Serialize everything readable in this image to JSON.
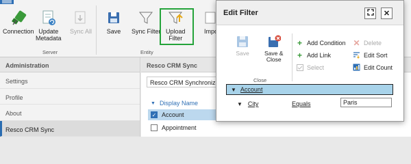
{
  "ribbon": {
    "buttons": [
      {
        "label": "Connection",
        "icon": "plug-icon"
      },
      {
        "label": "Update\nMetadata",
        "icon": "update-metadata-icon"
      },
      {
        "label": "Sync All",
        "icon": "sync-all-icon",
        "disabled": true
      },
      {
        "label": "Save",
        "icon": "save-icon"
      },
      {
        "label": "Sync Filter",
        "icon": "filter-icon"
      },
      {
        "label": "Upload\nFilter",
        "icon": "upload-filter-icon"
      },
      {
        "label": "Impo",
        "icon": "import-icon"
      }
    ],
    "groups": {
      "server": "Server",
      "entity": "Entity"
    }
  },
  "leftnav": {
    "header": "Administration",
    "items": [
      "Settings",
      "Profile",
      "About",
      "Resco CRM Sync"
    ]
  },
  "main": {
    "header": "Resco CRM Sync",
    "tab": "Resco CRM Synchronization",
    "column_header": "Display Name",
    "rows": [
      {
        "label": "Account",
        "checked": true
      },
      {
        "label": "Appointment",
        "checked": false
      }
    ]
  },
  "dialog": {
    "title": "Edit Filter",
    "toolbar": {
      "save": "Save",
      "save_close": "Save &\nClose",
      "close_group": "Close",
      "add_condition": "Add Condition",
      "add_link": "Add Link",
      "select": "Select",
      "delete": "Delete",
      "edit_sort": "Edit Sort",
      "edit_count": "Edit Count"
    },
    "tree": {
      "root": "Account",
      "condition": {
        "field": "City",
        "operator": "Equals",
        "value": "Paris"
      }
    }
  },
  "colors": {
    "accent_blue": "#2e6fb5",
    "highlight_green": "#24a33a",
    "selected_row": "#bcd8ee",
    "tree_root_bg": "#a8d3ea",
    "delete_red": "#d64a3a",
    "add_green": "#3a9a3a"
  }
}
